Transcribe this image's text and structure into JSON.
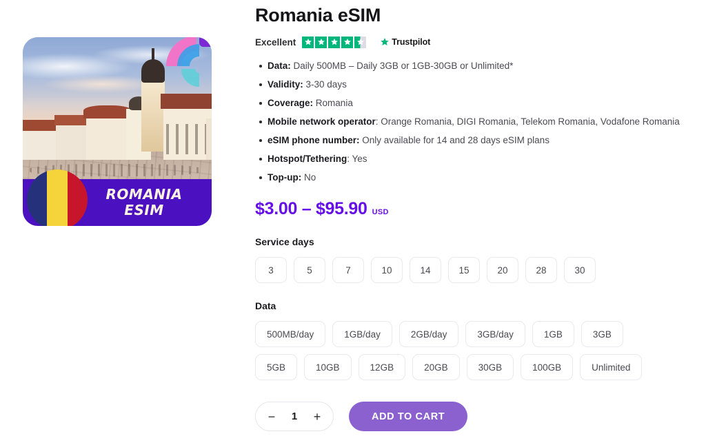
{
  "product": {
    "title": "Romania eSIM",
    "image": {
      "alt_scene": "Sibiu Grand Square at sunset",
      "ribbon_line1": "ROMANIA",
      "ribbon_line2": "ESIM",
      "flag_colors": [
        "#25327b",
        "#f5d33b",
        "#c7162b"
      ],
      "ribbon_color": "#4b10c0"
    }
  },
  "rating": {
    "word": "Excellent",
    "stars_filled": 4,
    "stars_total": 5,
    "half_star": true,
    "provider": "Trustpilot",
    "star_color": "#00b67a"
  },
  "specs": [
    {
      "label": "Data:",
      "value": "Daily 500MB – Daily 3GB or 1GB-30GB or Unlimited*"
    },
    {
      "label": "Validity:",
      "value": "3-30 days"
    },
    {
      "label": "Coverage:",
      "value": "Romania"
    },
    {
      "label": "Mobile network operator",
      "value": ": Orange Romania, DIGI Romania, Telekom Romania, Vodafone Romania"
    },
    {
      "label": "eSIM phone number:",
      "value": "Only available for 14 and 28 days eSIM plans"
    },
    {
      "label": "Hotspot/Tethering",
      "value": ": Yes"
    },
    {
      "label": "Top-up:",
      "value": "No"
    }
  ],
  "price": {
    "range": "$3.00 – $95.90",
    "currency": "USD",
    "color": "#6610e8"
  },
  "service_days": {
    "label": "Service days",
    "options": [
      "3",
      "5",
      "7",
      "10",
      "14",
      "15",
      "20",
      "28",
      "30"
    ]
  },
  "data_plans": {
    "label": "Data",
    "row1": [
      "500MB/day",
      "1GB/day",
      "2GB/day",
      "3GB/day",
      "1GB",
      "3GB"
    ],
    "row2": [
      "5GB",
      "10GB",
      "12GB",
      "20GB",
      "30GB",
      "100GB",
      "Unlimited"
    ]
  },
  "cart": {
    "decrement": "−",
    "quantity": "1",
    "increment": "+",
    "add_label": "ADD TO CART",
    "button_color": "#8b61d0"
  }
}
